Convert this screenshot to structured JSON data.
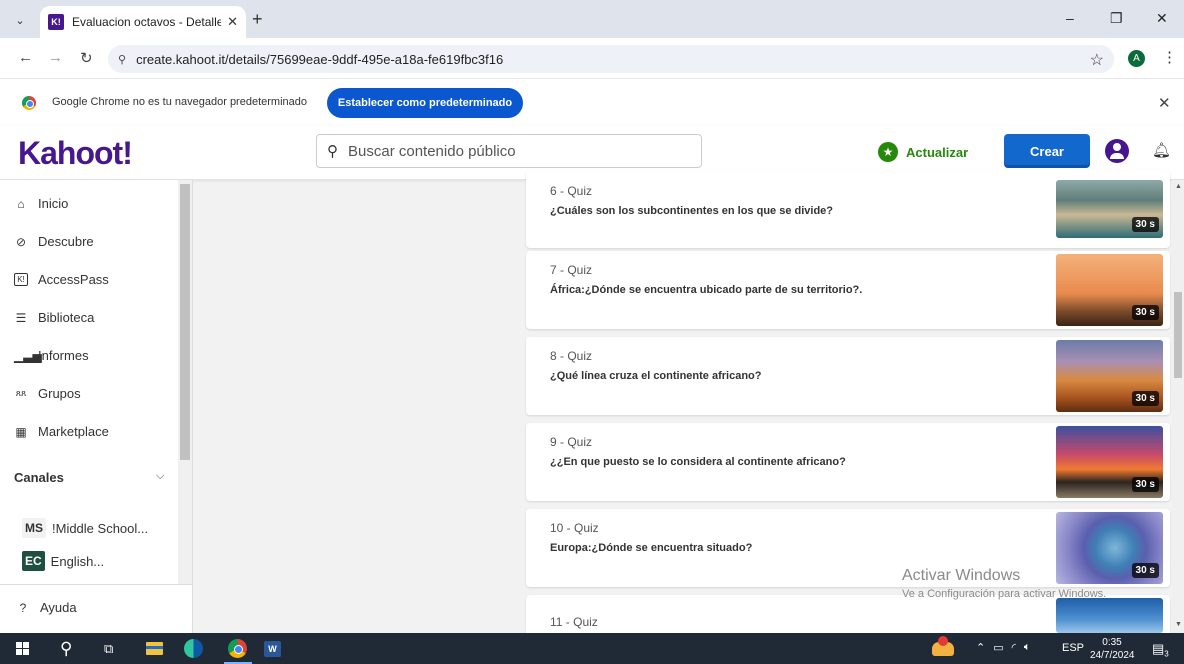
{
  "browser": {
    "tab_title": "Evaluacion octavos - Detalles - ",
    "tab_favicon": "K!",
    "url": "create.kahoot.it/details/75699eae-9ddf-495e-a18a-fe619fbc3f16",
    "profile_initial": "A",
    "infobar_text": "Google Chrome no es tu navegador predeterminado",
    "infobar_button": "Establecer como predeterminado"
  },
  "header": {
    "logo": "Kahoot!",
    "search_placeholder": "Buscar contenido público",
    "upgrade_label": "Actualizar",
    "create_label": "Crear"
  },
  "sidebar": {
    "items": [
      {
        "label": "Inicio",
        "icon": "home-icon"
      },
      {
        "label": "Descubre",
        "icon": "compass-icon"
      },
      {
        "label": "AccessPass",
        "icon": "accesspass-icon"
      },
      {
        "label": "Biblioteca",
        "icon": "list-icon"
      },
      {
        "label": "Informes",
        "icon": "chart-icon"
      },
      {
        "label": "Grupos",
        "icon": "group-icon"
      },
      {
        "label": "Marketplace",
        "icon": "store-icon"
      }
    ],
    "channels_title": "Canales",
    "channels": [
      {
        "badge": "MS",
        "label": "!Middle School..."
      },
      {
        "badge": "EC",
        "label": "English..."
      }
    ],
    "help_label": "Ayuda"
  },
  "questions": [
    {
      "number": "6 - Quiz",
      "text": "¿Cuáles son los subcontinentes en los que se divide?",
      "time": "30 s"
    },
    {
      "number": "7 - Quiz",
      "text": "África:¿Dónde se encuentra ubicado parte de su territorio?.",
      "time": "30 s"
    },
    {
      "number": "8 - Quiz",
      "text": "¿Qué línea cruza el continente africano?",
      "time": "30 s"
    },
    {
      "number": "9 - Quiz",
      "text": "¿¿En que puesto se lo considera al continente africano?",
      "time": "30 s"
    },
    {
      "number": "10 - Quiz",
      "text": "Europa:¿Dónde se encuentra situado?",
      "time": "30 s"
    },
    {
      "number": "11 - Quiz",
      "text": "",
      "time": ""
    }
  ],
  "watermark": {
    "title": "Activar Windows",
    "subtitle": "Ve a Configuración para activar Windows."
  },
  "taskbar": {
    "language": "ESP",
    "time": "0:35",
    "date": "24/7/2024",
    "notifications": "3"
  }
}
